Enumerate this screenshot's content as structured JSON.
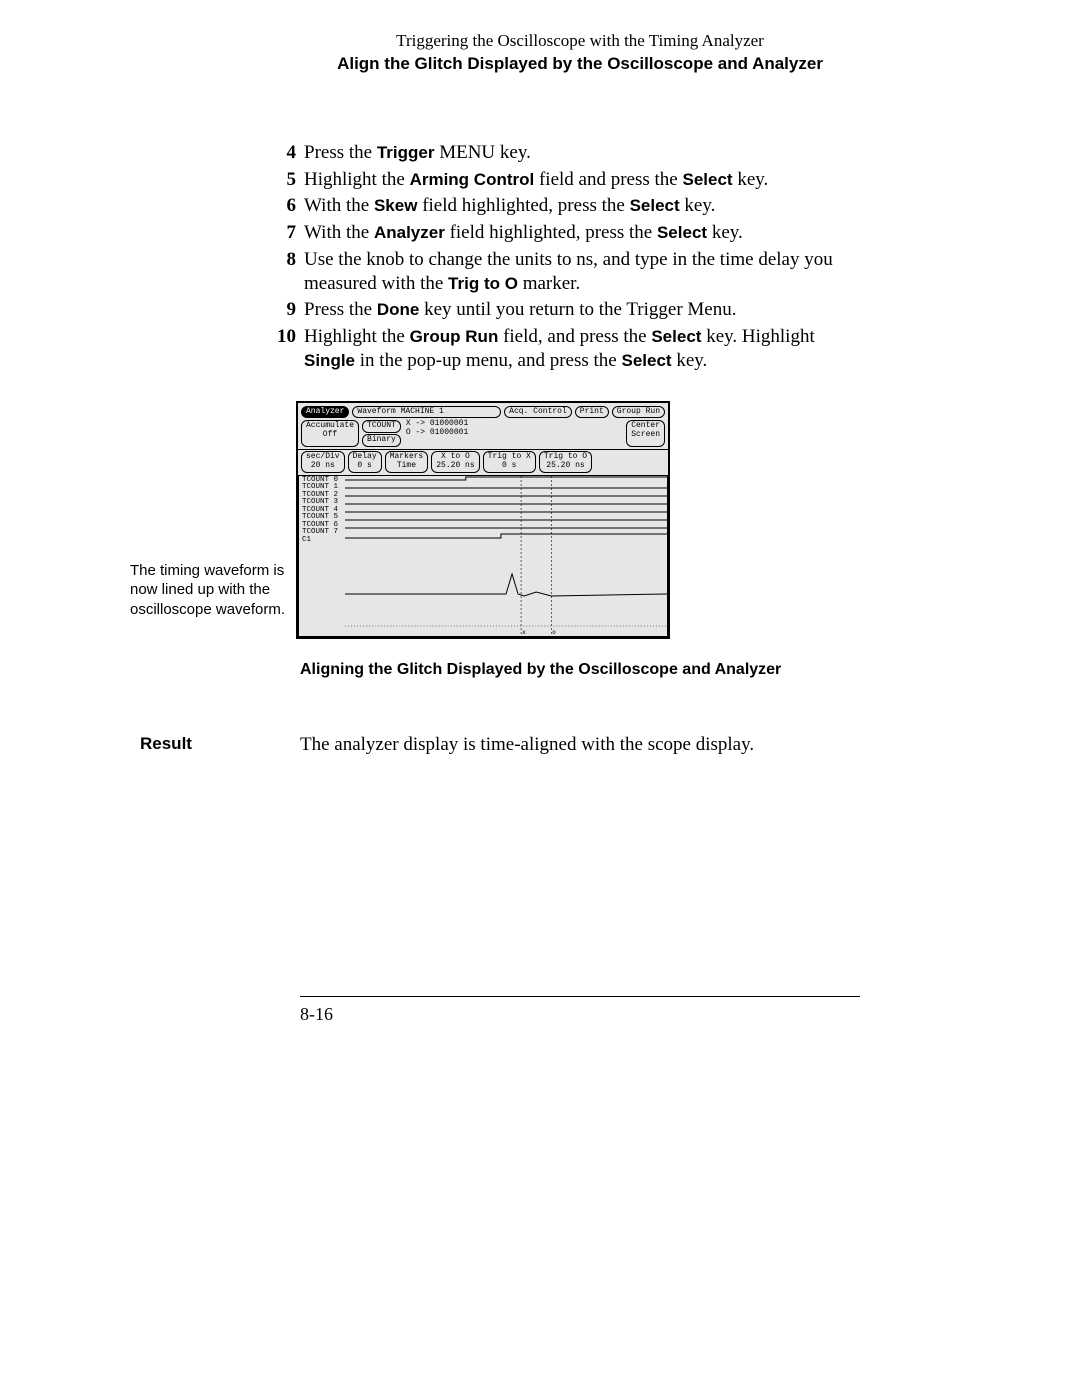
{
  "header": {
    "line1": "Triggering the Oscilloscope with the Timing Analyzer",
    "line2": "Align the Glitch Displayed by the Oscilloscope and Analyzer"
  },
  "steps": [
    {
      "num": "4",
      "parts": [
        "Press the ",
        {
          "b": "Trigger"
        },
        " MENU key."
      ]
    },
    {
      "num": "5",
      "parts": [
        "Highlight the ",
        {
          "b": "Arming Control"
        },
        " field and press the ",
        {
          "b": "Select"
        },
        " key."
      ]
    },
    {
      "num": "6",
      "parts": [
        "With the ",
        {
          "b": "Skew"
        },
        " field highlighted, press the ",
        {
          "b": "Select"
        },
        " key."
      ]
    },
    {
      "num": "7",
      "parts": [
        "With the ",
        {
          "b": "Analyzer"
        },
        " field highlighted, press the ",
        {
          "b": "Select"
        },
        " key."
      ]
    },
    {
      "num": "8",
      "parts": [
        "Use the knob to change the units to ns, and type in the time delay you measured with the ",
        {
          "b": "Trig to O"
        },
        " marker."
      ]
    },
    {
      "num": "9",
      "parts": [
        "Press the ",
        {
          "b": "Done"
        },
        " key until you return to the Trigger Menu."
      ]
    },
    {
      "num": "10",
      "parts": [
        "Highlight the ",
        {
          "b": "Group Run"
        },
        " field, and press the ",
        {
          "b": "Select"
        },
        " key.  Highlight ",
        {
          "b": "Single"
        },
        " in the pop-up menu, and press the ",
        {
          "b": "Select"
        },
        " key."
      ]
    }
  ],
  "figure": {
    "sideNote": "The timing  waveform is now lined up with the oscilloscope waveform.",
    "caption": "Aligning the Glitch Displayed by the Oscilloscope and Analyzer",
    "scope": {
      "row1": {
        "analyzer": "Analyzer",
        "title": "Waveform MACHINE 1",
        "acq": "Acq. Control",
        "print": "Print",
        "group": "Group Run"
      },
      "row2": {
        "acc1": "Accumulate",
        "acc2": "Off",
        "tcount": "TCOUNT",
        "binary": "Binary",
        "x": "X -> 01000001",
        "o": "O -> 01000001",
        "center1": "Center",
        "center2": "Screen"
      },
      "row3": {
        "secdiv1": "sec/Div",
        "secdiv2": "20 ns",
        "delay1": "Delay",
        "delay2": "0  s",
        "markers1": "Markers",
        "markers2": "Time",
        "xto1": "X to O",
        "xto2": "25.20 ns",
        "trigx1": "Trig to X",
        "trigx2": "0  s",
        "trigo1": "Trig to O",
        "trigo2": "25.20 ns"
      },
      "channels": [
        "TCOUNT 0",
        "TCOUNT 1",
        "TCOUNT 2",
        "TCOUNT 3",
        "TCOUNT 4",
        "TCOUNT 5",
        "TCOUNT 6",
        "TCOUNT 7",
        "C1"
      ]
    }
  },
  "result": {
    "label": "Result",
    "text": "The analyzer display is time-aligned with the scope display."
  },
  "pageNumber": "8-16"
}
